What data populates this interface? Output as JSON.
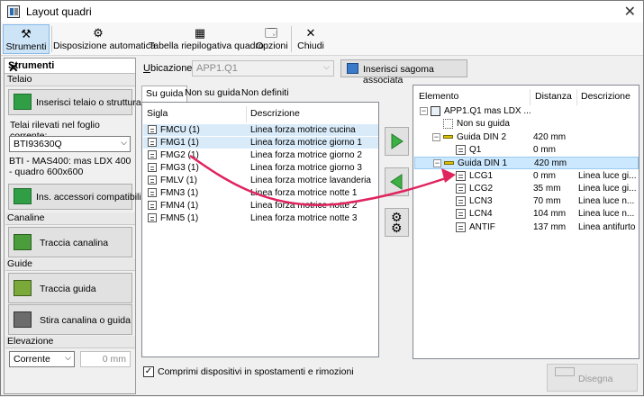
{
  "window": {
    "title": "Layout quadri"
  },
  "ribbon": {
    "buttons": [
      {
        "label": "Strumenti",
        "icon": "tools-icon"
      },
      {
        "label": "Disposizione automatica",
        "icon": "gear-icon"
      },
      {
        "label": "Tabella riepilogativa quadro",
        "icon": "table-icon"
      },
      {
        "label": "Opzioni",
        "icon": "options-icon"
      },
      {
        "label": "Chiudi",
        "icon": "close-icon"
      }
    ]
  },
  "left": {
    "title": "Strumenti",
    "telaio_section": "Telaio",
    "insert_frame_btn": "Inserisci telaio o struttura",
    "frames_label": "Telai rilevati nel foglio corrente:",
    "frame_select": "BTI93630Q",
    "frame_desc": "BTI - MAS400: mas LDX 400 - quadro 600x600",
    "compat_btn": "Ins. accessori compatibili",
    "canaline_section": "Canaline",
    "traccia_canalina_btn": "Traccia canalina",
    "guide_section": "Guide",
    "traccia_guida_btn": "Traccia guida",
    "stira_btn": "Stira canalina o guida",
    "elevazione_section": "Elevazione",
    "elev_select": "Corrente",
    "elev_value": "0 mm"
  },
  "center": {
    "ubicazione_label": "Ubicazione:",
    "ubicazione_value": "APP1.Q1",
    "insert_shape_btn": "Inserisci sagoma associata",
    "tabs": [
      "Su guida",
      "Non su guida",
      "Non definiti"
    ],
    "columns": [
      "Sigla",
      "Descrizione"
    ],
    "rows": [
      {
        "sigla": "FMCU (1)",
        "desc": "Linea forza motrice cucina"
      },
      {
        "sigla": "FMG1 (1)",
        "desc": "Linea forza motrice giorno 1"
      },
      {
        "sigla": "FMG2 (1)",
        "desc": "Linea forza motrice giorno 2"
      },
      {
        "sigla": "FMG3 (1)",
        "desc": "Linea forza motrice giorno 3"
      },
      {
        "sigla": "FMLV (1)",
        "desc": "Linea forza motrice lavanderia"
      },
      {
        "sigla": "FMN3 (1)",
        "desc": "Linea forza motrice notte 1"
      },
      {
        "sigla": "FMN4 (1)",
        "desc": "Linea forza motrice notte 2"
      },
      {
        "sigla": "FMN5 (1)",
        "desc": "Linea forza motrice notte 3"
      }
    ],
    "checkbox_label": "Comprimi dispositivi in spostamenti e rimozioni"
  },
  "tree": {
    "columns": [
      "Elemento",
      "Distanza",
      "Descrizione"
    ],
    "rows": [
      {
        "name": "APP1.Q1 mas LDX ...",
        "dist": "",
        "desc": ""
      },
      {
        "name": "Non su guida",
        "dist": "",
        "desc": ""
      },
      {
        "name": "Guida DIN 2",
        "dist": "420 mm",
        "desc": ""
      },
      {
        "name": "Q1",
        "dist": "0 mm",
        "desc": ""
      },
      {
        "name": "Guida DIN 1",
        "dist": "420 mm",
        "desc": ""
      },
      {
        "name": "LCG1",
        "dist": "0 mm",
        "desc": "Linea luce gi..."
      },
      {
        "name": "LCG2",
        "dist": "35 mm",
        "desc": "Linea luce gi..."
      },
      {
        "name": "LCN3",
        "dist": "70 mm",
        "desc": "Linea luce n..."
      },
      {
        "name": "LCN4",
        "dist": "104 mm",
        "desc": "Linea luce n..."
      },
      {
        "name": "ANTIF",
        "dist": "137 mm",
        "desc": "Linea antifurto"
      }
    ]
  },
  "disegna_btn": "Disegna",
  "colors": {
    "accent_arrow": "#e0245e",
    "green": "#3cb043",
    "highlight": "#d9ebf9",
    "selection": "#cce8ff"
  }
}
